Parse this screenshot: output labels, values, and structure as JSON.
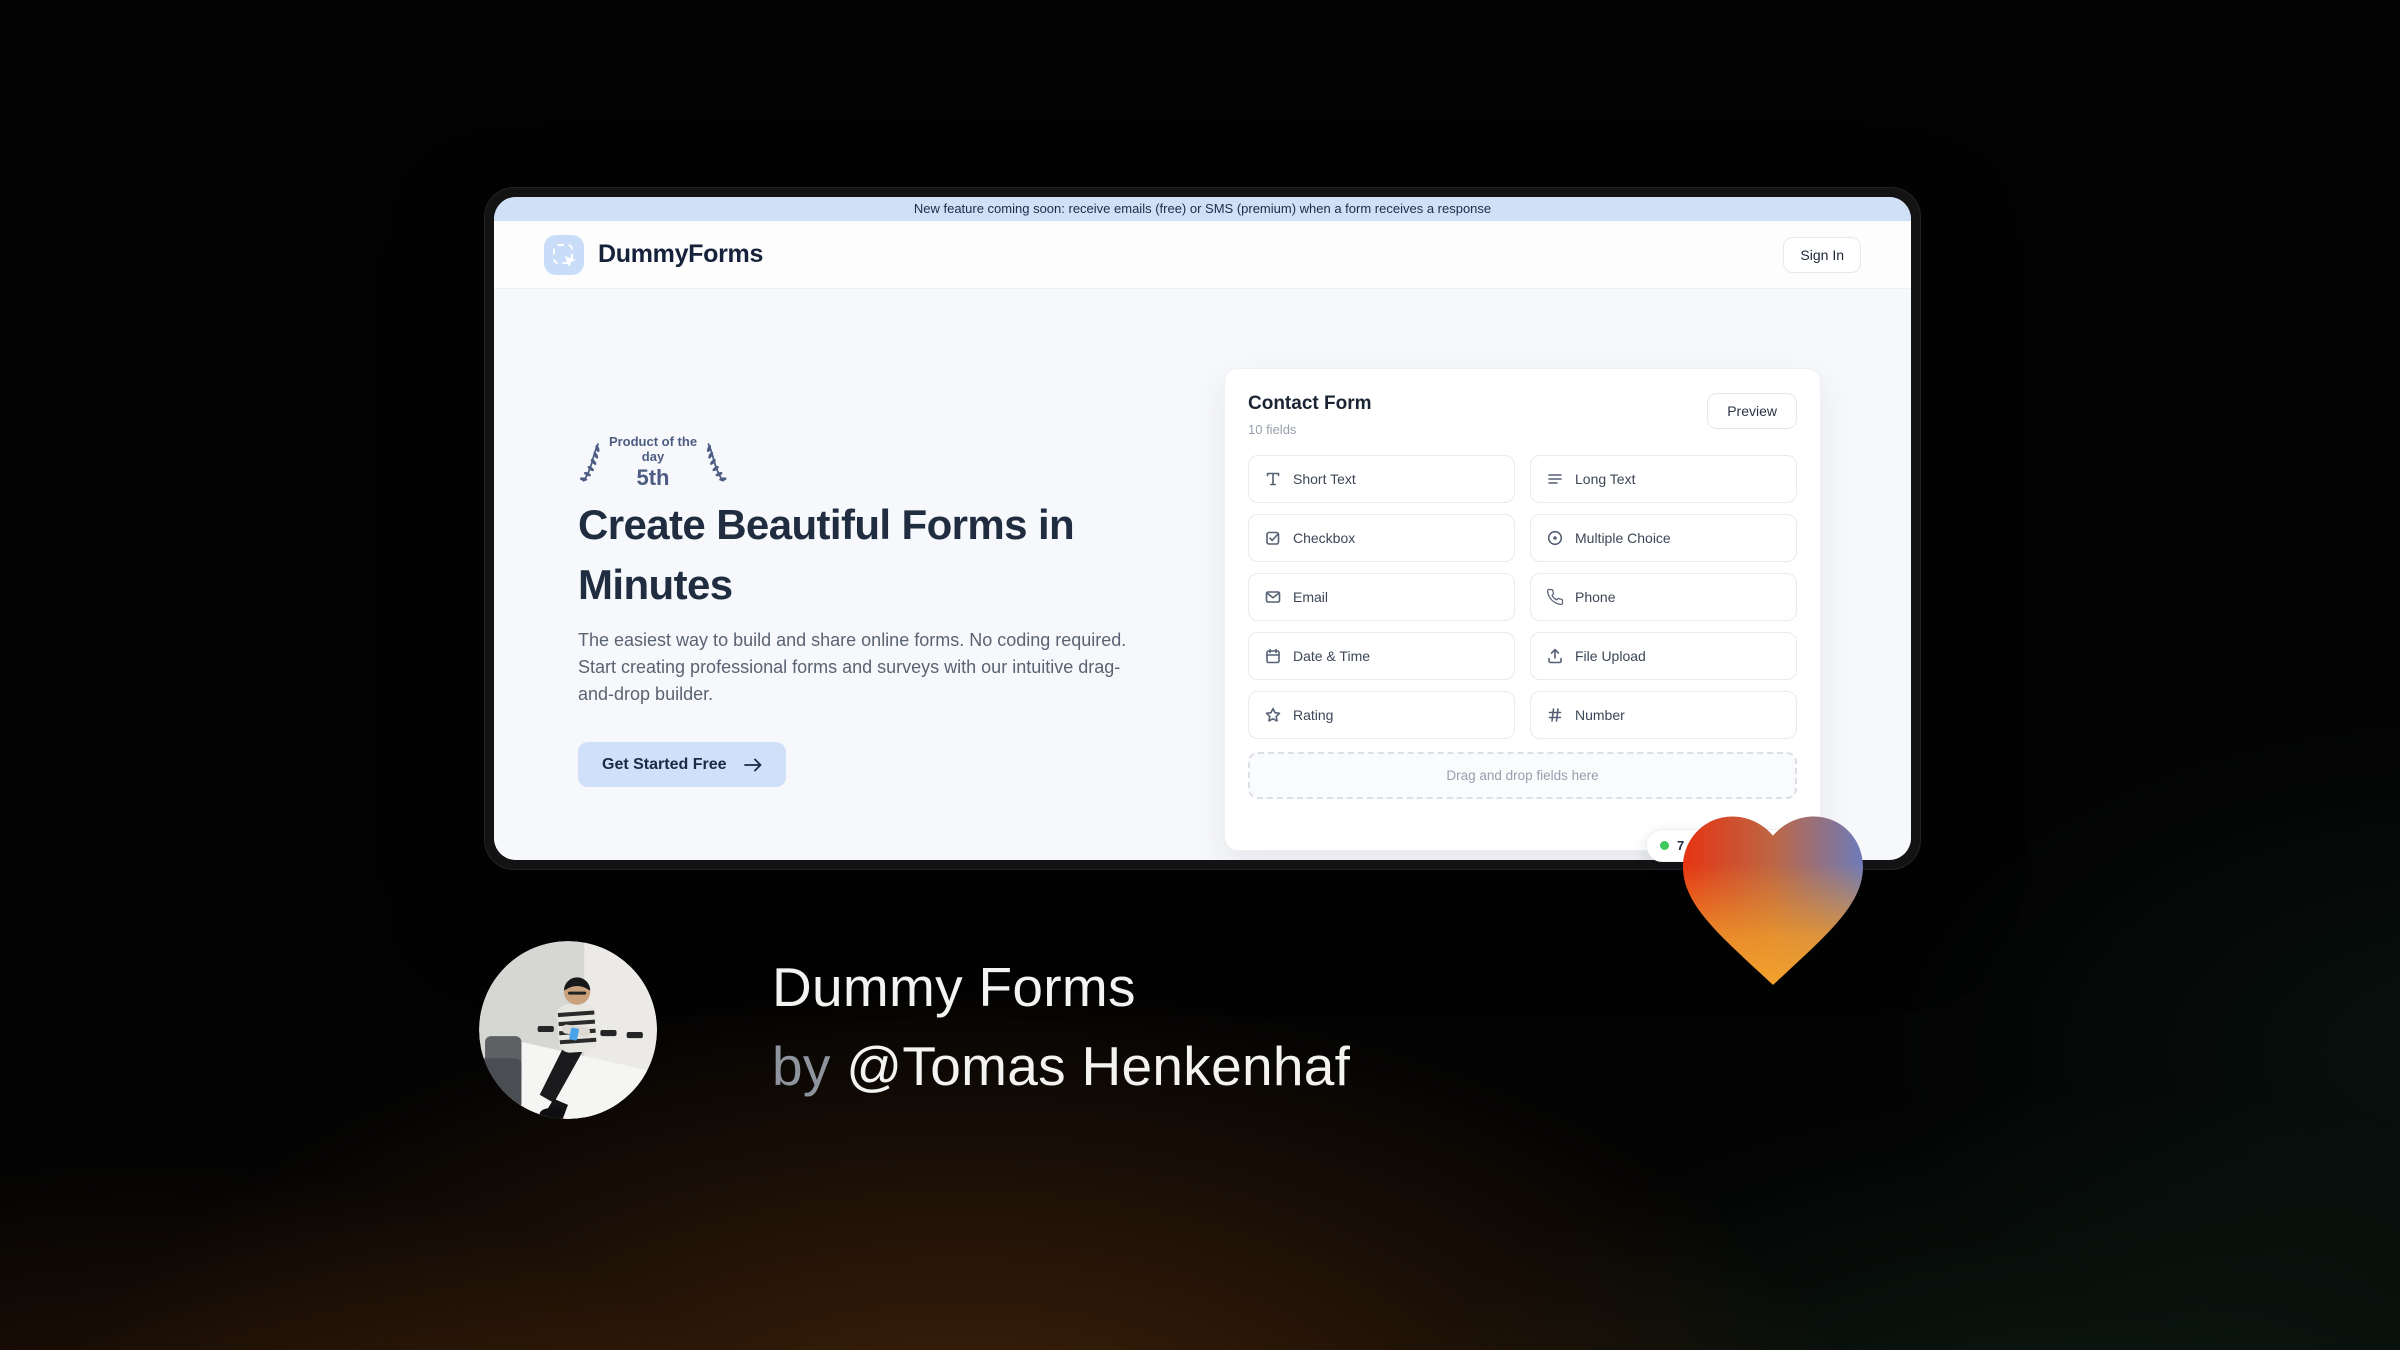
{
  "banner": {
    "text": "New feature coming soon: receive emails (free) or SMS (premium) when a form receives a response"
  },
  "header": {
    "brand": "DummyForms",
    "sign_in_label": "Sign In"
  },
  "hero": {
    "award_line1": "Product of the day",
    "award_line2": "5th",
    "headline": "Create Beautiful Forms in Minutes",
    "subtext": "The easiest way to build and share online forms. No coding required. Start creating professional forms and surveys with our intuitive drag-and-drop builder.",
    "cta_label": "Get Started Free"
  },
  "form_card": {
    "title": "Contact Form",
    "subtitle": "10 fields",
    "preview_label": "Preview",
    "fields": [
      {
        "label": "Short Text",
        "icon": "short-text-icon"
      },
      {
        "label": "Long Text",
        "icon": "long-text-icon"
      },
      {
        "label": "Checkbox",
        "icon": "checkbox-icon"
      },
      {
        "label": "Multiple Choice",
        "icon": "radio-icon"
      },
      {
        "label": "Email",
        "icon": "envelope-icon"
      },
      {
        "label": "Phone",
        "icon": "phone-icon"
      },
      {
        "label": "Date & Time",
        "icon": "calendar-icon"
      },
      {
        "label": "File Upload",
        "icon": "upload-icon"
      },
      {
        "label": "Rating",
        "icon": "star-icon"
      },
      {
        "label": "Number",
        "icon": "hash-icon"
      }
    ],
    "dropzone_text": "Drag and drop fields here",
    "status_badge": {
      "text": "7",
      "dot_color": "#3ec95c"
    }
  },
  "footer": {
    "title": "Dummy Forms",
    "byline_prefix": "by",
    "byline_handle": "@Tomas Henkenhaf"
  },
  "colors": {
    "accent_blue": "#cfe0f8",
    "banner_bg": "#cfe0f7",
    "heart_red": "#e63413",
    "heart_blue": "#6d7bba",
    "heart_orange": "#f09c29",
    "status_green": "#3ec95c"
  }
}
